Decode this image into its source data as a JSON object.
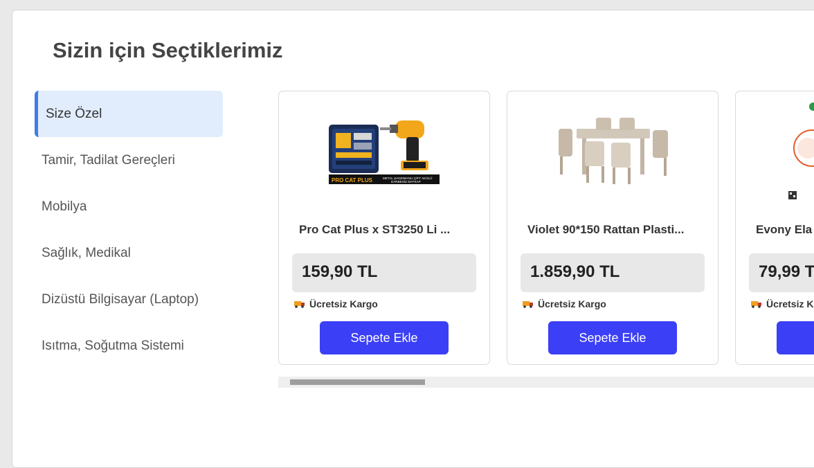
{
  "section": {
    "title": "Sizin için Seçtiklerimiz"
  },
  "sidebar": {
    "items": [
      {
        "label": "Size Özel",
        "active": true
      },
      {
        "label": "Tamir, Tadilat Gereçleri",
        "active": false
      },
      {
        "label": "Mobilya",
        "active": false
      },
      {
        "label": "Sağlık, Medikal",
        "active": false
      },
      {
        "label": "Dizüstü Bilgisayar (Laptop)",
        "active": false
      },
      {
        "label": "Isıtma, Soğutma Sistemi",
        "active": false
      }
    ]
  },
  "products": [
    {
      "name": "Pro Cat Plus x ST3250 Li ...",
      "price": "159,90 TL",
      "shipping": "Ücretsiz Kargo",
      "button": "Sepete Ekle",
      "image_icon": "cordless-drill-kit-image",
      "image_text": [
        "PRO CAT PLUS",
        "METAL ŞANZIMANLI ÇİFT AKÜLÜ",
        "DARBESİZ MATKAP"
      ]
    },
    {
      "name": "Violet 90*150 Rattan Plasti...",
      "price": "1.859,90 TL",
      "shipping": "Ücretsiz Kargo",
      "button": "Sepete Ekle",
      "image_icon": "rattan-dining-set-image"
    },
    {
      "name": "Evony Ela",
      "price": "79,99 T",
      "shipping": "Ücretsiz K",
      "button": "S",
      "image_icon": "product-box-image"
    }
  ],
  "colors": {
    "accent": "#3b3ff5",
    "active_bg": "#e1edfd",
    "active_border": "#3f7ce5",
    "price_bg": "#e8e8e8"
  },
  "scrollbar": {
    "position": 0.03
  }
}
